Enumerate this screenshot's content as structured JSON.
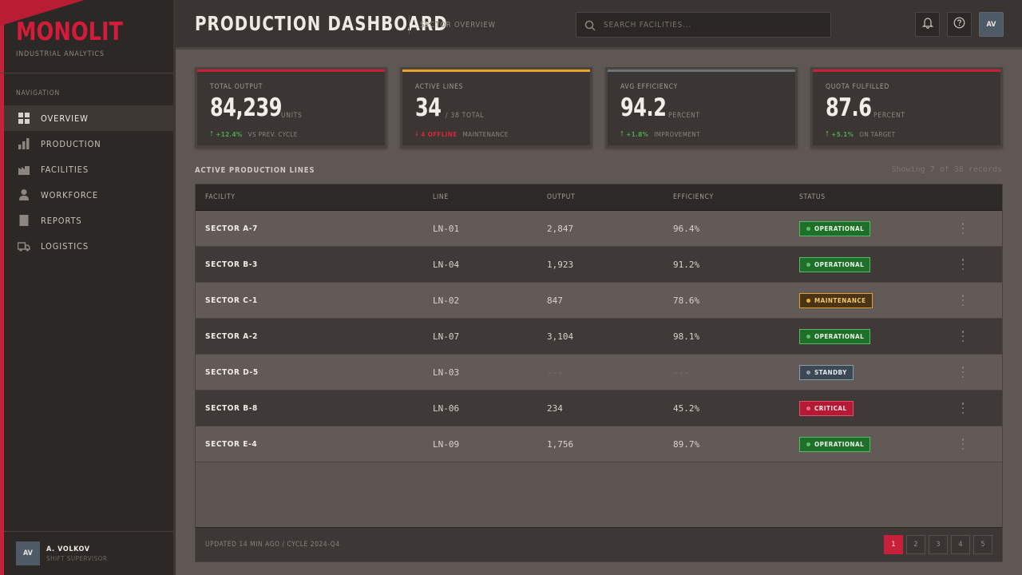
{
  "brand": {
    "name": "MONOLIT",
    "subtitle": "INDUSTRIAL ANALYTICS",
    "accent": "#c8203a"
  },
  "sidebar": {
    "heading": "NAVIGATION",
    "items": [
      {
        "label": "OVERVIEW",
        "icon": "grid-icon",
        "active": true
      },
      {
        "label": "PRODUCTION",
        "icon": "bar-chart-icon"
      },
      {
        "label": "FACILITIES",
        "icon": "factory-icon"
      },
      {
        "label": "WORKFORCE",
        "icon": "person-icon"
      },
      {
        "label": "REPORTS",
        "icon": "document-icon"
      },
      {
        "label": "LOGISTICS",
        "icon": "truck-icon"
      }
    ],
    "user": {
      "initials": "AV",
      "name": "A. VOLKOV",
      "role": "SHIFT SUPERVISOR"
    }
  },
  "header": {
    "title": "PRODUCTION DASHBOARD",
    "subtitle": "SECTOR OVERVIEW",
    "search_placeholder": "SEARCH FACILITIES...",
    "avatar_initials": "AV"
  },
  "kpis": [
    {
      "label": "TOTAL OUTPUT",
      "value": "84,239",
      "unit": "UNITS",
      "delta": "+12.4%",
      "direction": "up",
      "note": "VS PREV. CYCLE",
      "color": "#c8203a"
    },
    {
      "label": "ACTIVE LINES",
      "value": "34",
      "unit": "/ 38 TOTAL",
      "delta": "4 OFFLINE",
      "direction": "down",
      "note": "MAINTENANCE",
      "color": "#e8a32a"
    },
    {
      "label": "AVG EFFICIENCY",
      "value": "94.2",
      "unit": "PERCENT",
      "delta": "+1.8%",
      "direction": "up",
      "note": "IMPROVEMENT",
      "color": "#6e7378"
    },
    {
      "label": "QUOTA FULFILLED",
      "value": "87.6",
      "unit": "PERCENT",
      "delta": "+5.1%",
      "direction": "up",
      "note": "ON TARGET",
      "color": "#c8203a"
    }
  ],
  "table": {
    "title": "ACTIVE PRODUCTION LINES",
    "records_text": "Showing 7 of 38 records",
    "columns": [
      "FACILITY",
      "LINE",
      "OUTPUT",
      "EFFICIENCY",
      "STATUS"
    ],
    "rows": [
      {
        "facility": "SECTOR A-7",
        "line": "LN-01",
        "output": "2,847",
        "efficiency": "96.4%",
        "status": "OPERATIONAL",
        "status_kind": "operational"
      },
      {
        "facility": "SECTOR B-3",
        "line": "LN-04",
        "output": "1,923",
        "efficiency": "91.2%",
        "status": "OPERATIONAL",
        "status_kind": "operational"
      },
      {
        "facility": "SECTOR C-1",
        "line": "LN-02",
        "output": "847",
        "efficiency": "78.6%",
        "status": "MAINTENANCE",
        "status_kind": "maintenance"
      },
      {
        "facility": "SECTOR A-2",
        "line": "LN-07",
        "output": "3,104",
        "efficiency": "98.1%",
        "status": "OPERATIONAL",
        "status_kind": "operational"
      },
      {
        "facility": "SECTOR D-5",
        "line": "LN-03",
        "output": "---",
        "efficiency": "---",
        "status": "STANDBY",
        "status_kind": "standby"
      },
      {
        "facility": "SECTOR B-8",
        "line": "LN-06",
        "output": "234",
        "efficiency": "45.2%",
        "status": "CRITICAL",
        "status_kind": "critical"
      },
      {
        "facility": "SECTOR E-4",
        "line": "LN-09",
        "output": "1,756",
        "efficiency": "89.7%",
        "status": "OPERATIONAL",
        "status_kind": "operational"
      }
    ],
    "footer_text": "UPDATED 14 MIN AGO / CYCLE 2024-Q4",
    "pages": [
      "1",
      "2",
      "3",
      "4",
      "5"
    ],
    "current_page": "1"
  }
}
